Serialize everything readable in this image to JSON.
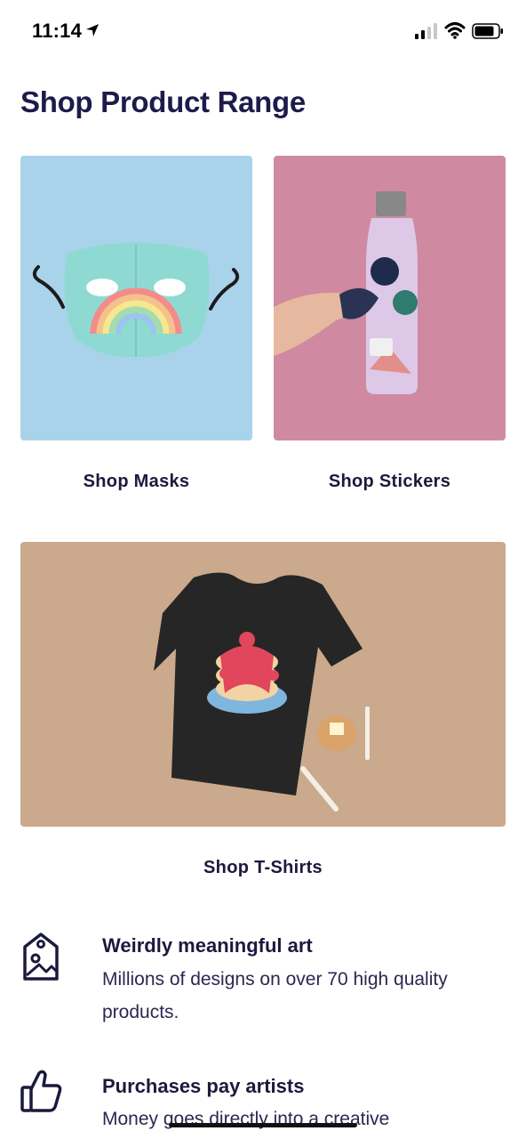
{
  "status_bar": {
    "time": "11:14"
  },
  "page_title": "Shop Product Range",
  "products": [
    {
      "label": "Shop Masks"
    },
    {
      "label": "Shop Stickers"
    },
    {
      "label": "Shop T-Shirts"
    }
  ],
  "features": [
    {
      "title": "Weirdly meaningful art",
      "text": "Millions of designs on over 70 high quality products."
    },
    {
      "title": "Purchases pay artists",
      "text": "Money goes directly into a creative"
    }
  ],
  "colors": {
    "heading": "#1e1b4b",
    "masks_bg": "#a9d3ea",
    "stickers_bg": "#cf8aa1",
    "tshirts_bg": "#caa98c"
  },
  "icons": [
    "location-arrow-icon",
    "cellular-signal-icon",
    "wifi-icon",
    "battery-icon",
    "art-tag-icon",
    "thumbs-up-icon"
  ]
}
